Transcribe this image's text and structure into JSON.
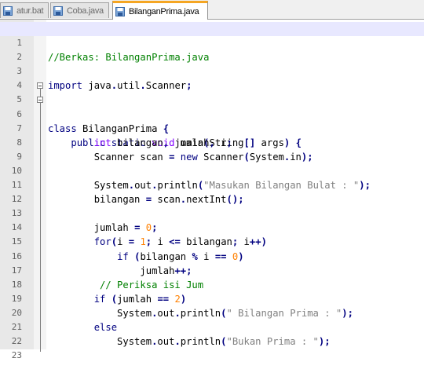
{
  "tabs": [
    {
      "label": "atur.bat",
      "active": false
    },
    {
      "label": "Coba.java",
      "active": false
    },
    {
      "label": "BilanganPrima.java",
      "active": true
    }
  ],
  "editor": {
    "lines": [
      {
        "n": "1",
        "text": "//Berkas: BilanganPrima.java"
      },
      {
        "n": "2",
        "text": ""
      },
      {
        "n": "3",
        "text": "import java.util.Scanner;"
      },
      {
        "n": "4",
        "text": ""
      },
      {
        "n": "5",
        "text": "class BilanganPrima {"
      },
      {
        "n": "6",
        "text": "    public static void main(String[] args) {"
      },
      {
        "n": "7",
        "text": "        int bilangan, jumlah, i;"
      },
      {
        "n": "8",
        "text": "        Scanner scan = new Scanner(System.in);"
      },
      {
        "n": "9",
        "text": ""
      },
      {
        "n": "10",
        "text": "        System.out.println(\"Masukan Bilangan Bulat : \");"
      },
      {
        "n": "11",
        "text": "        bilangan = scan.nextInt();"
      },
      {
        "n": "12",
        "text": ""
      },
      {
        "n": "13",
        "text": "        jumlah = 0;"
      },
      {
        "n": "14",
        "text": "        for(i = 1; i <= bilangan; i++)"
      },
      {
        "n": "15",
        "text": "            if (bilangan % i == 0)"
      },
      {
        "n": "16",
        "text": "                jumlah++;"
      },
      {
        "n": "17",
        "text": "         // Periksa isi Jum"
      },
      {
        "n": "18",
        "text": "        if (jumlah == 2)"
      },
      {
        "n": "19",
        "text": "            System.out.println(\" Bilangan Prima : \");"
      },
      {
        "n": "20",
        "text": "        else"
      },
      {
        "n": "21",
        "text": "            System.out.println(\"Bukan Prima : \");"
      },
      {
        "n": "22",
        "text": ""
      },
      {
        "n": "23",
        "text": ""
      }
    ]
  },
  "colors": {
    "keyword": "#000080",
    "type_keyword": "#8000ff",
    "comment": "#008000",
    "string": "#808080",
    "number": "#ff8000",
    "current_line": "#e8e8ff",
    "active_tab_accent": "#f5a623"
  },
  "icons": {
    "tab_icon": "save-disk-icon",
    "fold_marker": "fold-minus-icon"
  }
}
